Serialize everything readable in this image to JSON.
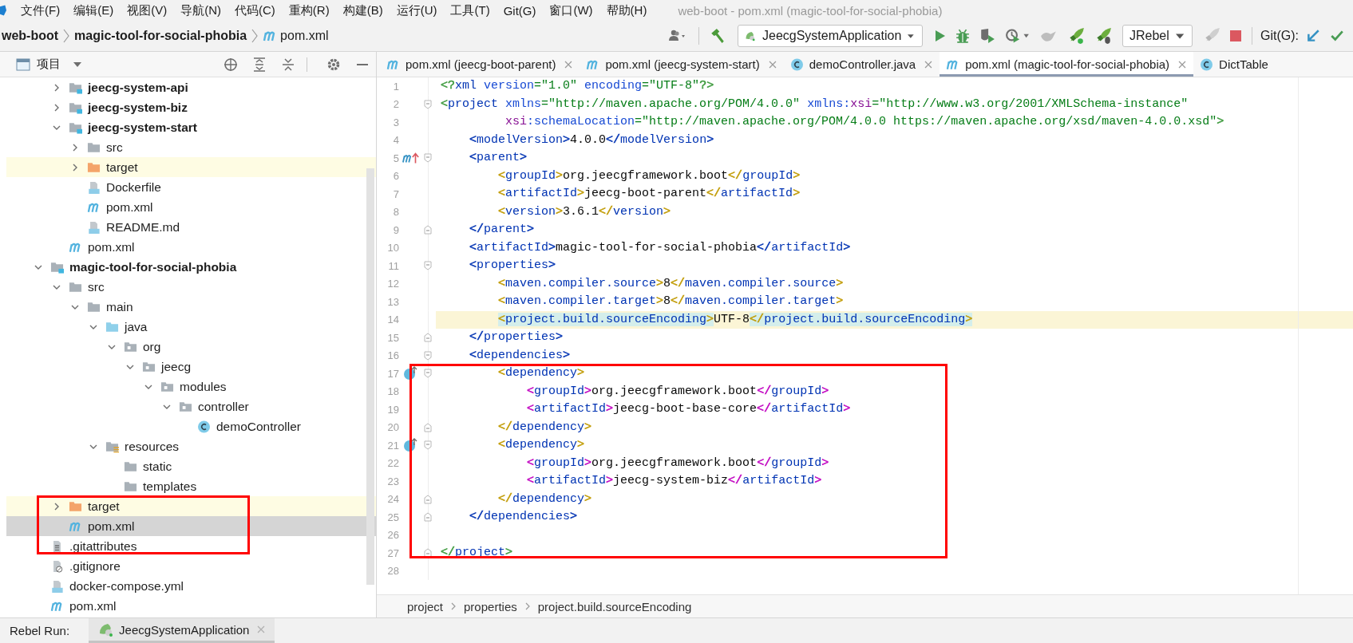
{
  "window": {
    "title": "web-boot - pom.xml (magic-tool-for-social-phobia)"
  },
  "menu": [
    "文件(F)",
    "编辑(E)",
    "视图(V)",
    "导航(N)",
    "代码(C)",
    "重构(R)",
    "构建(B)",
    "运行(U)",
    "工具(T)",
    "Git(G)",
    "窗口(W)",
    "帮助(H)"
  ],
  "breadcrumb": [
    {
      "label": "web-boot",
      "bold": true,
      "kind": "module"
    },
    {
      "label": "magic-tool-for-social-phobia",
      "bold": true,
      "kind": "module"
    },
    {
      "label": "pom.xml",
      "bold": false,
      "kind": "maven"
    }
  ],
  "toolbar": {
    "run_config": "JeecgSystemApplication",
    "rebel_config": "JRebel",
    "git_label": "Git(G):"
  },
  "project_panel": {
    "title": "项目"
  },
  "tree": {
    "partial_group": [
      {
        "label": "jeecg-system-api",
        "kind": "module",
        "bold": true,
        "expanded": false,
        "selected": false,
        "highlighted": false
      },
      {
        "label": "jeecg-system-biz",
        "kind": "module",
        "bold": true,
        "expanded": false,
        "selected": false,
        "highlighted": false
      },
      {
        "label": "jeecg-system-start",
        "kind": "module",
        "bold": true,
        "expanded": true,
        "selected": false,
        "highlighted": false,
        "children": [
          {
            "label": "src",
            "kind": "folder",
            "bold": false,
            "expanded": false,
            "selected": false,
            "highlighted": false
          },
          {
            "label": "target",
            "kind": "excluded",
            "bold": false,
            "expanded": false,
            "selected": false,
            "highlighted": true
          },
          {
            "label": "Dockerfile",
            "kind": "docker",
            "bold": false,
            "selected": false,
            "highlighted": false
          },
          {
            "label": "pom.xml",
            "kind": "maven",
            "bold": false,
            "selected": false,
            "highlighted": false
          },
          {
            "label": "README.md",
            "kind": "markdown",
            "bold": false,
            "selected": false,
            "highlighted": false
          }
        ]
      },
      {
        "label": "pom.xml",
        "kind": "maven",
        "bold": false,
        "selected": false,
        "highlighted": false
      }
    ],
    "items": [
      {
        "label": "magic-tool-for-social-phobia",
        "kind": "module",
        "bold": true,
        "expanded": true,
        "selected": false,
        "highlighted": false,
        "children": [
          {
            "label": "src",
            "kind": "folder",
            "bold": false,
            "expanded": true,
            "selected": false,
            "highlighted": false,
            "children": [
              {
                "label": "main",
                "kind": "folder",
                "bold": false,
                "expanded": true,
                "selected": false,
                "highlighted": false,
                "children": [
                  {
                    "label": "java",
                    "kind": "sources",
                    "bold": false,
                    "expanded": true,
                    "selected": false,
                    "highlighted": false,
                    "children": [
                      {
                        "label": "org",
                        "kind": "package",
                        "bold": false,
                        "expanded": true,
                        "selected": false,
                        "highlighted": false,
                        "children": [
                          {
                            "label": "jeecg",
                            "kind": "package",
                            "bold": false,
                            "expanded": true,
                            "selected": false,
                            "highlighted": false,
                            "children": [
                              {
                                "label": "modules",
                                "kind": "package",
                                "bold": false,
                                "expanded": true,
                                "selected": false,
                                "highlighted": false,
                                "children": [
                                  {
                                    "label": "controller",
                                    "kind": "package",
                                    "bold": false,
                                    "expanded": true,
                                    "selected": false,
                                    "highlighted": false,
                                    "children": [
                                      {
                                        "label": "demoController",
                                        "kind": "class",
                                        "bold": false,
                                        "selected": false,
                                        "highlighted": false
                                      }
                                    ]
                                  }
                                ]
                              }
                            ]
                          }
                        ]
                      }
                    ]
                  },
                  {
                    "label": "resources",
                    "kind": "resources",
                    "bold": false,
                    "expanded": true,
                    "selected": false,
                    "highlighted": false,
                    "children": [
                      {
                        "label": "static",
                        "kind": "folder",
                        "bold": false,
                        "selected": false,
                        "highlighted": false
                      },
                      {
                        "label": "templates",
                        "kind": "folder",
                        "bold": false,
                        "selected": false,
                        "highlighted": false
                      }
                    ]
                  }
                ]
              }
            ]
          },
          {
            "label": "target",
            "kind": "excluded",
            "bold": false,
            "expanded": false,
            "selected": false,
            "highlighted": true
          },
          {
            "label": "pom.xml",
            "kind": "maven",
            "bold": false,
            "selected": true,
            "highlighted": false
          }
        ]
      },
      {
        "label": ".gitattributes",
        "kind": "text",
        "bold": false,
        "selected": false,
        "highlighted": false
      },
      {
        "label": ".gitignore",
        "kind": "ignore",
        "bold": false,
        "selected": false,
        "highlighted": false
      },
      {
        "label": "docker-compose.yml",
        "kind": "compose",
        "bold": false,
        "selected": false,
        "highlighted": false
      },
      {
        "label": "pom.xml",
        "kind": "maven",
        "bold": false,
        "selected": false,
        "highlighted": false
      }
    ]
  },
  "editor_tabs": [
    {
      "label": "pom.xml (jeecg-boot-parent)",
      "kind": "maven",
      "selected": false,
      "closable": true
    },
    {
      "label": "pom.xml (jeecg-system-start)",
      "kind": "maven",
      "selected": false,
      "closable": true
    },
    {
      "label": "demoController.java",
      "kind": "class",
      "selected": false,
      "closable": true
    },
    {
      "label": "pom.xml (magic-tool-for-social-phobia)",
      "kind": "maven",
      "selected": true,
      "closable": true
    },
    {
      "label": "DictTable",
      "kind": "class",
      "selected": false,
      "closable": false
    }
  ],
  "editor": {
    "lines": [
      {
        "number": "1",
        "kind": "plain",
        "current": false,
        "fold_open": false,
        "fold_close": false,
        "tokens": [
          {
            "kind": "bracket",
            "text": "<?",
            "color": "#3d9a3d"
          },
          {
            "kind": "tag",
            "text": "xml"
          },
          {
            "kind": "attr",
            "text": " version"
          },
          {
            "kind": "value",
            "text": "=\"1.0\""
          },
          {
            "kind": "attr",
            "text": " encoding"
          },
          {
            "kind": "value",
            "text": "=\"UTF-8\""
          },
          {
            "kind": "bracket",
            "text": "?>",
            "color": "#3d9a3d"
          }
        ]
      },
      {
        "number": "2",
        "kind": "plain",
        "current": false,
        "fold_open": true,
        "fold_close": false,
        "tokens": [
          {
            "kind": "bracket",
            "text": "<",
            "color": "#3d9a3d"
          },
          {
            "kind": "tag",
            "text": "project"
          },
          {
            "kind": "attr",
            "text": " xmlns"
          },
          {
            "kind": "value",
            "text": "=\"http://maven.apache.org/POM/4.0.0\""
          },
          {
            "kind": "attr",
            "text": " xmlns:"
          },
          {
            "kind": "ns",
            "text": "xsi"
          },
          {
            "kind": "value",
            "text": "=\"http://www.w3.org/2001/XMLSchema-instance\""
          }
        ]
      },
      {
        "number": "3",
        "kind": "plain",
        "current": false,
        "fold_open": false,
        "fold_close": false,
        "tokens": [
          {
            "kind": "ns",
            "text": "         xsi"
          },
          {
            "kind": "attr",
            "text": ":schemaLocation"
          },
          {
            "kind": "value",
            "text": "=\"http://maven.apache.org/POM/4.0.0 https://maven.apache.org/xsd/maven-4.0.0.xsd\""
          },
          {
            "kind": "bracket",
            "text": ">",
            "color": "#3d9a3d"
          }
        ]
      },
      {
        "number": "4",
        "kind": "plain",
        "current": false,
        "fold_open": false,
        "fold_close": false,
        "tokens": [
          {
            "kind": "bracket",
            "text": "    <",
            "color": "#0033b3"
          },
          {
            "kind": "tag",
            "text": "modelVersion"
          },
          {
            "kind": "bracket",
            "text": ">",
            "color": "#0033b3"
          },
          {
            "kind": "text",
            "text": "4.0.0"
          },
          {
            "kind": "bracket",
            "text": "</",
            "color": "#0033b3"
          },
          {
            "kind": "tag",
            "text": "modelVersion"
          },
          {
            "kind": "bracket",
            "text": ">",
            "color": "#0033b3"
          }
        ]
      },
      {
        "number": "5",
        "kind": "parent",
        "current": false,
        "fold_open": true,
        "fold_close": false,
        "tokens": [
          {
            "kind": "bracket",
            "text": "    <",
            "color": "#0033b3"
          },
          {
            "kind": "tag",
            "text": "parent"
          },
          {
            "kind": "bracket",
            "text": ">",
            "color": "#0033b3"
          }
        ]
      },
      {
        "number": "6",
        "kind": "plain",
        "current": false,
        "fold_open": false,
        "fold_close": false,
        "tokens": [
          {
            "kind": "bracket",
            "text": "        <",
            "color": "#c09a00"
          },
          {
            "kind": "tag",
            "text": "groupId"
          },
          {
            "kind": "bracket",
            "text": ">",
            "color": "#c09a00"
          },
          {
            "kind": "text",
            "text": "org.jeecgframework.boot"
          },
          {
            "kind": "bracket",
            "text": "</",
            "color": "#c09a00"
          },
          {
            "kind": "tag",
            "text": "groupId"
          },
          {
            "kind": "bracket",
            "text": ">",
            "color": "#c09a00"
          }
        ]
      },
      {
        "number": "7",
        "kind": "plain",
        "current": false,
        "fold_open": false,
        "fold_close": false,
        "tokens": [
          {
            "kind": "bracket",
            "text": "        <",
            "color": "#c09a00"
          },
          {
            "kind": "tag",
            "text": "artifactId"
          },
          {
            "kind": "bracket",
            "text": ">",
            "color": "#c09a00"
          },
          {
            "kind": "text",
            "text": "jeecg-boot-parent"
          },
          {
            "kind": "bracket",
            "text": "</",
            "color": "#c09a00"
          },
          {
            "kind": "tag",
            "text": "artifactId"
          },
          {
            "kind": "bracket",
            "text": ">",
            "color": "#c09a00"
          }
        ]
      },
      {
        "number": "8",
        "kind": "plain",
        "current": false,
        "fold_open": false,
        "fold_close": false,
        "tokens": [
          {
            "kind": "bracket",
            "text": "        <",
            "color": "#c09a00"
          },
          {
            "kind": "tag",
            "text": "version"
          },
          {
            "kind": "bracket",
            "text": ">",
            "color": "#c09a00"
          },
          {
            "kind": "text",
            "text": "3.6.1"
          },
          {
            "kind": "bracket",
            "text": "</",
            "color": "#c09a00"
          },
          {
            "kind": "tag",
            "text": "version"
          },
          {
            "kind": "bracket",
            "text": ">",
            "color": "#c09a00"
          }
        ]
      },
      {
        "number": "9",
        "kind": "plain",
        "current": false,
        "fold_open": false,
        "fold_close": true,
        "tokens": [
          {
            "kind": "bracket",
            "text": "    </",
            "color": "#0033b3"
          },
          {
            "kind": "tag",
            "text": "parent"
          },
          {
            "kind": "bracket",
            "text": ">",
            "color": "#0033b3"
          }
        ]
      },
      {
        "number": "10",
        "kind": "plain",
        "current": false,
        "fold_open": false,
        "fold_close": false,
        "tokens": [
          {
            "kind": "bracket",
            "text": "    <",
            "color": "#0033b3"
          },
          {
            "kind": "tag",
            "text": "artifactId"
          },
          {
            "kind": "bracket",
            "text": ">",
            "color": "#0033b3"
          },
          {
            "kind": "text",
            "text": "magic-tool-for-social-phobia"
          },
          {
            "kind": "bracket",
            "text": "</",
            "color": "#0033b3"
          },
          {
            "kind": "tag",
            "text": "artifactId"
          },
          {
            "kind": "bracket",
            "text": ">",
            "color": "#0033b3"
          }
        ]
      },
      {
        "number": "11",
        "kind": "plain",
        "current": false,
        "fold_open": true,
        "fold_close": false,
        "tokens": [
          {
            "kind": "bracket",
            "text": "    <",
            "color": "#0033b3"
          },
          {
            "kind": "tag",
            "text": "properties"
          },
          {
            "kind": "bracket",
            "text": ">",
            "color": "#0033b3"
          }
        ]
      },
      {
        "number": "12",
        "kind": "plain",
        "current": false,
        "fold_open": false,
        "fold_close": false,
        "tokens": [
          {
            "kind": "bracket",
            "text": "        <",
            "color": "#c09a00"
          },
          {
            "kind": "tag",
            "text": "maven.compiler.source"
          },
          {
            "kind": "bracket",
            "text": ">",
            "color": "#c09a00"
          },
          {
            "kind": "text",
            "text": "8"
          },
          {
            "kind": "bracket",
            "text": "</",
            "color": "#c09a00"
          },
          {
            "kind": "tag",
            "text": "maven.compiler.source"
          },
          {
            "kind": "bracket",
            "text": ">",
            "color": "#c09a00"
          }
        ]
      },
      {
        "number": "13",
        "kind": "plain",
        "current": false,
        "fold_open": false,
        "fold_close": false,
        "tokens": [
          {
            "kind": "bracket",
            "text": "        <",
            "color": "#c09a00"
          },
          {
            "kind": "tag",
            "text": "maven.compiler.target"
          },
          {
            "kind": "bracket",
            "text": ">",
            "color": "#c09a00"
          },
          {
            "kind": "text",
            "text": "8"
          },
          {
            "kind": "bracket",
            "text": "</",
            "color": "#c09a00"
          },
          {
            "kind": "tag",
            "text": "maven.compiler.target"
          },
          {
            "kind": "bracket",
            "text": ">",
            "color": "#c09a00"
          }
        ]
      },
      {
        "number": "14",
        "kind": "plain",
        "current": true,
        "fold_open": false,
        "fold_close": false,
        "tokens": [
          {
            "kind": "bracket",
            "text": "        <",
            "color": "#c09a00",
            "matched": true
          },
          {
            "kind": "tag",
            "text": "project.build.sourceEncoding",
            "matched": true
          },
          {
            "kind": "bracket",
            "text": ">",
            "color": "#c09a00",
            "matched": true
          },
          {
            "kind": "text",
            "text": "UTF-8",
            "matched": false
          },
          {
            "kind": "bracket",
            "text": "</",
            "color": "#c09a00",
            "matched": true
          },
          {
            "kind": "tag",
            "text": "project.build.sourceEncoding",
            "matched": true
          },
          {
            "kind": "bracket",
            "text": ">",
            "color": "#c09a00",
            "matched": true
          }
        ]
      },
      {
        "number": "15",
        "kind": "plain",
        "current": false,
        "fold_open": false,
        "fold_close": true,
        "tokens": [
          {
            "kind": "bracket",
            "text": "    </",
            "color": "#0033b3"
          },
          {
            "kind": "tag",
            "text": "properties"
          },
          {
            "kind": "bracket",
            "text": ">",
            "color": "#0033b3"
          }
        ]
      },
      {
        "number": "16",
        "kind": "plain",
        "current": false,
        "fold_open": true,
        "fold_close": false,
        "tokens": [
          {
            "kind": "bracket",
            "text": "    <",
            "color": "#0033b3"
          },
          {
            "kind": "tag",
            "text": "dependencies"
          },
          {
            "kind": "bracket",
            "text": ">",
            "color": "#0033b3"
          }
        ]
      },
      {
        "number": "17",
        "kind": "dependency",
        "current": false,
        "fold_open": true,
        "fold_close": false,
        "tokens": [
          {
            "kind": "bracket",
            "text": "        <",
            "color": "#c09a00"
          },
          {
            "kind": "tag",
            "text": "dependency"
          },
          {
            "kind": "bracket",
            "text": ">",
            "color": "#c09a00"
          }
        ]
      },
      {
        "number": "18",
        "kind": "plain",
        "current": false,
        "fold_open": false,
        "fold_close": false,
        "tokens": [
          {
            "kind": "bracket",
            "text": "            <",
            "color": "#c000c0"
          },
          {
            "kind": "tag",
            "text": "groupId"
          },
          {
            "kind": "bracket",
            "text": ">",
            "color": "#c000c0"
          },
          {
            "kind": "text",
            "text": "org.jeecgframework.boot"
          },
          {
            "kind": "bracket",
            "text": "</",
            "color": "#c000c0"
          },
          {
            "kind": "tag",
            "text": "groupId"
          },
          {
            "kind": "bracket",
            "text": ">",
            "color": "#c000c0"
          }
        ]
      },
      {
        "number": "19",
        "kind": "plain",
        "current": false,
        "fold_open": false,
        "fold_close": false,
        "tokens": [
          {
            "kind": "bracket",
            "text": "            <",
            "color": "#c000c0"
          },
          {
            "kind": "tag",
            "text": "artifactId"
          },
          {
            "kind": "bracket",
            "text": ">",
            "color": "#c000c0"
          },
          {
            "kind": "text",
            "text": "jeecg-boot-base-core"
          },
          {
            "kind": "bracket",
            "text": "</",
            "color": "#c000c0"
          },
          {
            "kind": "tag",
            "text": "artifactId"
          },
          {
            "kind": "bracket",
            "text": ">",
            "color": "#c000c0"
          }
        ]
      },
      {
        "number": "20",
        "kind": "plain",
        "current": false,
        "fold_open": false,
        "fold_close": true,
        "tokens": [
          {
            "kind": "bracket",
            "text": "        </",
            "color": "#c09a00"
          },
          {
            "kind": "tag",
            "text": "dependency"
          },
          {
            "kind": "bracket",
            "text": ">",
            "color": "#c09a00"
          }
        ]
      },
      {
        "number": "21",
        "kind": "dependency",
        "current": false,
        "fold_open": true,
        "fold_close": false,
        "tokens": [
          {
            "kind": "bracket",
            "text": "        <",
            "color": "#c09a00"
          },
          {
            "kind": "tag",
            "text": "dependency"
          },
          {
            "kind": "bracket",
            "text": ">",
            "color": "#c09a00"
          }
        ]
      },
      {
        "number": "22",
        "kind": "plain",
        "current": false,
        "fold_open": false,
        "fold_close": false,
        "tokens": [
          {
            "kind": "bracket",
            "text": "            <",
            "color": "#c000c0"
          },
          {
            "kind": "tag",
            "text": "groupId"
          },
          {
            "kind": "bracket",
            "text": ">",
            "color": "#c000c0"
          },
          {
            "kind": "text",
            "text": "org.jeecgframework.boot"
          },
          {
            "kind": "bracket",
            "text": "</",
            "color": "#c000c0"
          },
          {
            "kind": "tag",
            "text": "groupId"
          },
          {
            "kind": "bracket",
            "text": ">",
            "color": "#c000c0"
          }
        ]
      },
      {
        "number": "23",
        "kind": "plain",
        "current": false,
        "fold_open": false,
        "fold_close": false,
        "tokens": [
          {
            "kind": "bracket",
            "text": "            <",
            "color": "#c000c0"
          },
          {
            "kind": "tag",
            "text": "artifactId"
          },
          {
            "kind": "bracket",
            "text": ">",
            "color": "#c000c0"
          },
          {
            "kind": "text",
            "text": "jeecg-system-biz"
          },
          {
            "kind": "bracket",
            "text": "</",
            "color": "#c000c0"
          },
          {
            "kind": "tag",
            "text": "artifactId"
          },
          {
            "kind": "bracket",
            "text": ">",
            "color": "#c000c0"
          }
        ]
      },
      {
        "number": "24",
        "kind": "plain",
        "current": false,
        "fold_open": false,
        "fold_close": true,
        "tokens": [
          {
            "kind": "bracket",
            "text": "        </",
            "color": "#c09a00"
          },
          {
            "kind": "tag",
            "text": "dependency"
          },
          {
            "kind": "bracket",
            "text": ">",
            "color": "#c09a00"
          }
        ]
      },
      {
        "number": "25",
        "kind": "plain",
        "current": false,
        "fold_open": false,
        "fold_close": true,
        "tokens": [
          {
            "kind": "bracket",
            "text": "    </",
            "color": "#0033b3"
          },
          {
            "kind": "tag",
            "text": "dependencies"
          },
          {
            "kind": "bracket",
            "text": ">",
            "color": "#0033b3"
          }
        ]
      },
      {
        "number": "26",
        "kind": "plain",
        "current": false,
        "fold_open": false,
        "fold_close": false
      },
      {
        "number": "27",
        "kind": "plain",
        "current": false,
        "fold_open": false,
        "fold_close": true,
        "tokens": [
          {
            "kind": "bracket",
            "text": "</",
            "color": "#3d9a3d"
          },
          {
            "kind": "tag",
            "text": "project"
          },
          {
            "kind": "bracket",
            "text": ">",
            "color": "#3d9a3d"
          }
        ]
      },
      {
        "number": "28",
        "kind": "plain",
        "current": false,
        "fold_open": false,
        "fold_close": false
      }
    ],
    "breadcrumb": [
      "project",
      "properties",
      "project.build.sourceEncoding"
    ]
  },
  "annotation_boxes": [
    {
      "color": "#ff0000"
    },
    {
      "color": "#ff0000"
    }
  ],
  "run_bar": {
    "label": "Rebel Run:",
    "tab": "JeecgSystemApplication"
  }
}
